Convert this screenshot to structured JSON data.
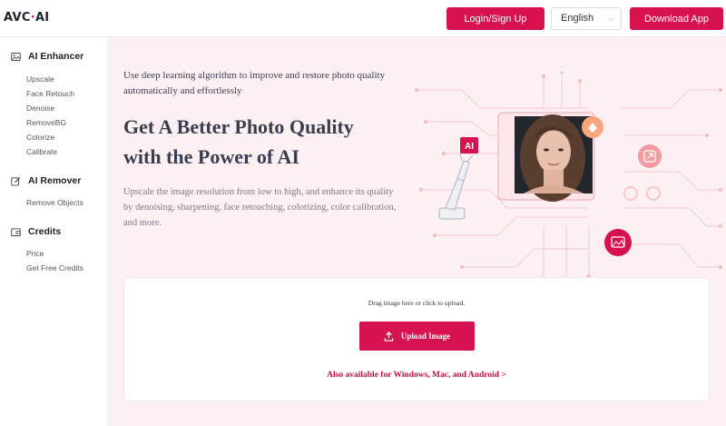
{
  "header": {
    "logo_main": "AVC",
    "logo_dot": "·",
    "logo_suffix": "AI",
    "login_label": "Login/Sign Up",
    "language_value": "English",
    "download_label": "Download App"
  },
  "sidebar": {
    "sections": [
      {
        "title": "AI Enhancer",
        "icon": "image-icon",
        "items": [
          "Upscale",
          "Face Retouch",
          "Denoise",
          "RemoveBG",
          "Colorize",
          "Calibrate"
        ]
      },
      {
        "title": "AI Remover",
        "icon": "edit-icon",
        "items": [
          "Remove Objects"
        ]
      },
      {
        "title": "Credits",
        "icon": "wallet-icon",
        "items": [
          "Price",
          "Get Free Credits"
        ]
      }
    ]
  },
  "hero": {
    "tagline": "Use deep learning algorithm to improve and restore photo quality automatically and effortlessly",
    "headline_line1": "Get A Better Photo Quality",
    "headline_line2": "with the Power of AI",
    "description": "Upscale the image resolution from low to high, and enhance its quality by denoising, sharpening, face retouching, colorizing, color calibration, and more.",
    "ai_badge": "AI"
  },
  "upload": {
    "drag_text": "Drag image here or click to upload.",
    "button_label": "Upload Image",
    "availability_text": "Also available for Windows, Mac, and Android >"
  },
  "colors": {
    "accent": "#d7134f",
    "hero_bg": "#fdf0f3",
    "text_dark": "#3a3d4f"
  }
}
